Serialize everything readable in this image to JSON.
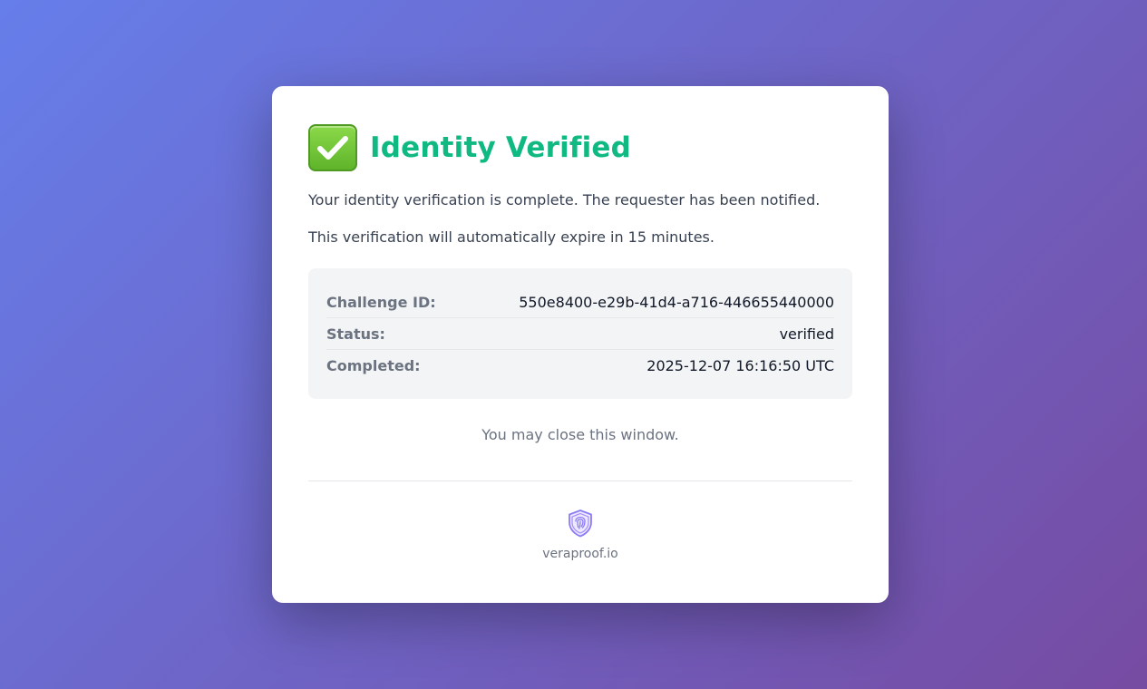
{
  "card": {
    "title": "Identity Verified",
    "title_icon": "check-mark-button-icon",
    "message_complete": "Your identity verification is complete. The requester has been notified.",
    "message_expire": "This verification will automatically expire in 15 minutes.",
    "details": [
      {
        "label": "Challenge ID:",
        "value": "550e8400-e29b-41d4-a716-446655440000"
      },
      {
        "label": "Status:",
        "value": "verified"
      },
      {
        "label": "Completed:",
        "value": "2025-12-07 16:16:50 UTC"
      }
    ],
    "close_note": "You may close this window.",
    "footer": {
      "logo_icon": "shield-fingerprint-icon",
      "brand": "veraproof.io"
    }
  },
  "colors": {
    "background_start": "#667eea",
    "background_end": "#764ba2",
    "success": "#10b981",
    "brand_icon": "#8b7cf6"
  }
}
